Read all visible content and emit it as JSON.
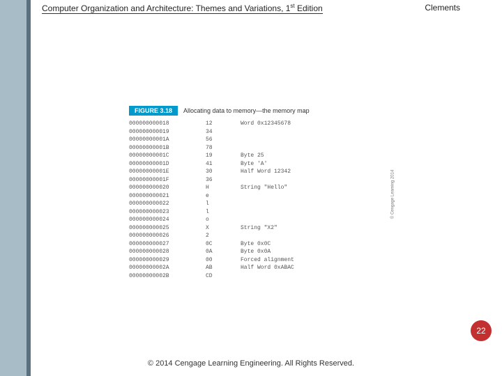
{
  "header": {
    "title_a": "Computer Organization and Architecture: Themes and Variations, 1",
    "title_sup": "st",
    "title_b": " Edition",
    "author": "Clements"
  },
  "figure": {
    "badge": "FIGURE 3.18",
    "caption": "Allocating data to memory—the memory map",
    "credit": "© Cengage Learning 2014",
    "rows": [
      {
        "addr": "000000000018",
        "val": "12",
        "desc": "Word 0x12345678"
      },
      {
        "addr": "000000000019",
        "val": "34",
        "desc": ""
      },
      {
        "addr": "00000000001A",
        "val": "56",
        "desc": ""
      },
      {
        "addr": "00000000001B",
        "val": "78",
        "desc": ""
      },
      {
        "addr": "00000000001C",
        "val": "19",
        "desc": "Byte 25"
      },
      {
        "addr": "00000000001D",
        "val": "41",
        "desc": "Byte 'A'"
      },
      {
        "addr": "00000000001E",
        "val": "30",
        "desc": "Half Word 12342"
      },
      {
        "addr": "00000000001F",
        "val": "36",
        "desc": ""
      },
      {
        "addr": "000000000020",
        "val": "H",
        "desc": "String \"Hello\""
      },
      {
        "addr": "000000000021",
        "val": "e",
        "desc": ""
      },
      {
        "addr": "000000000022",
        "val": "l",
        "desc": ""
      },
      {
        "addr": "000000000023",
        "val": "l",
        "desc": ""
      },
      {
        "addr": "000000000024",
        "val": "o",
        "desc": ""
      },
      {
        "addr": "000000000025",
        "val": "X",
        "desc": "String \"X2\""
      },
      {
        "addr": "000000000026",
        "val": "2",
        "desc": ""
      },
      {
        "addr": "000000000027",
        "val": "0C",
        "desc": "Byte 0x0C"
      },
      {
        "addr": "000000000028",
        "val": "0A",
        "desc": "Byte 0x0A"
      },
      {
        "addr": "000000000029",
        "val": "00",
        "desc": "Forced alignment"
      },
      {
        "addr": "00000000002A",
        "val": "AB",
        "desc": "Half Word 0xABAC"
      },
      {
        "addr": "00000000002B",
        "val": "CD",
        "desc": ""
      }
    ]
  },
  "page_number": "22",
  "footer": "© 2014 Cengage Learning Engineering. All Rights Reserved."
}
